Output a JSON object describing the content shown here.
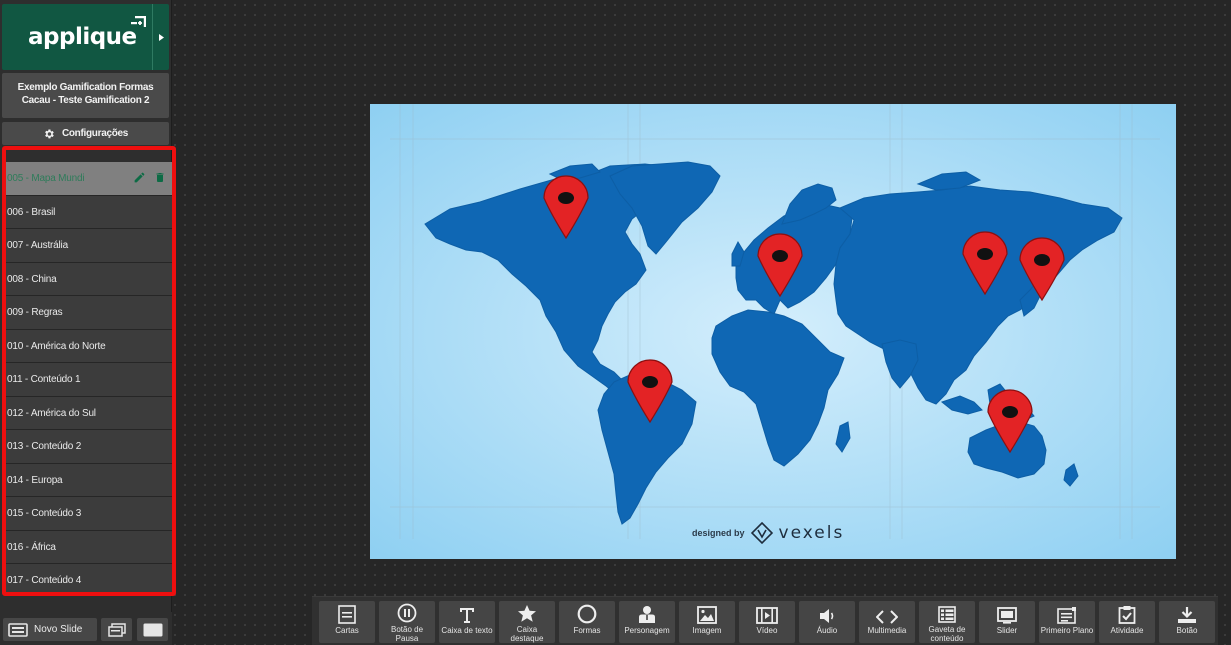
{
  "app": {
    "logo_text": "applique",
    "project_title_line1": "Exemplo Gamification Formas",
    "project_title_line2": "Cacau - Teste Gamification 2",
    "settings_label": "Configurações"
  },
  "slides": [
    {
      "label": "005 - Mapa Mundi",
      "active": true
    },
    {
      "label": "006 - Brasil"
    },
    {
      "label": "007 - Austrália"
    },
    {
      "label": "008 - China"
    },
    {
      "label": "009 - Regras"
    },
    {
      "label": "010 - América do Norte"
    },
    {
      "label": "011 - Conteúdo 1"
    },
    {
      "label": "012 - América do Sul"
    },
    {
      "label": "013 - Conteúdo 2"
    },
    {
      "label": "014 - Europa"
    },
    {
      "label": "015 - Conteúdo 3"
    },
    {
      "label": "016 - África"
    },
    {
      "label": "017 - Conteúdo 4"
    }
  ],
  "footer": {
    "new_slide_label": "Novo Slide"
  },
  "canvas": {
    "credit_prefix": "designed by",
    "credit_brand": "vexels",
    "map_colors": {
      "ocean": "#a9dcf5",
      "land": "#0f67b4",
      "pin": "#e32325"
    }
  },
  "toolbar": [
    {
      "label": "Cartas",
      "icon": "cards-icon"
    },
    {
      "label": "Botão de Pausa",
      "icon": "pause-icon"
    },
    {
      "label": "Caixa de texto",
      "icon": "text-icon"
    },
    {
      "label": "Caixa destaque",
      "icon": "star-icon"
    },
    {
      "label": "Formas",
      "icon": "circle-icon"
    },
    {
      "label": "Personagem",
      "icon": "character-icon"
    },
    {
      "label": "Imagem",
      "icon": "image-icon"
    },
    {
      "label": "Vídeo",
      "icon": "film-icon"
    },
    {
      "label": "Áudio",
      "icon": "speaker-icon"
    },
    {
      "label": "Multimedia",
      "icon": "code-icon"
    },
    {
      "label": "Gaveta de conteúdo",
      "icon": "drawer-icon"
    },
    {
      "label": "Slider",
      "icon": "slider-icon"
    },
    {
      "label": "Primeiro Plano",
      "icon": "foreground-icon"
    },
    {
      "label": "Atividade",
      "icon": "activity-icon"
    },
    {
      "label": "Botão",
      "icon": "download-icon"
    }
  ]
}
